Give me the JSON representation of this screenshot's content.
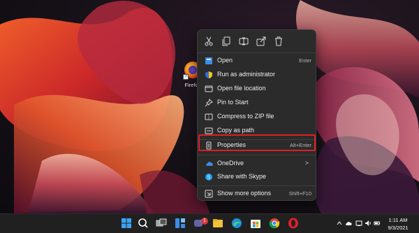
{
  "desktop": {
    "icon_label": "Firefox",
    "wallpaper": "abstract-ribbons"
  },
  "context_menu": {
    "quick_actions": [
      {
        "name": "cut",
        "icon": "scissors-icon"
      },
      {
        "name": "copy",
        "icon": "copy-icon"
      },
      {
        "name": "rename",
        "icon": "rename-icon"
      },
      {
        "name": "share",
        "icon": "share-icon"
      },
      {
        "name": "delete",
        "icon": "trash-icon"
      }
    ],
    "items": [
      {
        "label": "Open",
        "shortcut": "Enter",
        "icon": "open-icon"
      },
      {
        "label": "Run as administrator",
        "shortcut": "",
        "icon": "shield-icon"
      },
      {
        "label": "Open file location",
        "shortcut": "",
        "icon": "folder-icon"
      },
      {
        "label": "Pin to Start",
        "shortcut": "",
        "icon": "pin-icon"
      },
      {
        "label": "Compress to ZIP file",
        "shortcut": "",
        "icon": "zip-icon"
      },
      {
        "label": "Copy as path",
        "shortcut": "",
        "icon": "copy-path-icon"
      },
      {
        "label": "Properties",
        "shortcut": "Alt+Enter",
        "icon": "properties-icon"
      },
      {
        "label": "OneDrive",
        "shortcut": "",
        "icon": "cloud-icon",
        "submenu": ">"
      },
      {
        "label": "Share with Skype",
        "shortcut": "",
        "icon": "skype-icon"
      },
      {
        "label": "Show more options",
        "shortcut": "Shift+F10",
        "icon": "more-options-icon"
      }
    ],
    "highlighted_item": "Properties",
    "highlight_color": "#e02020"
  },
  "taskbar": {
    "apps": [
      "start-icon",
      "search-icon",
      "task-view-icon",
      "widgets-icon",
      "teams-chat-icon",
      "file-explorer-icon",
      "edge-icon",
      "store-icon",
      "chrome-icon",
      "opera-icon"
    ],
    "chat_badge": "1",
    "clock": {
      "time": "1:11 AM",
      "date": "9/3/2021"
    },
    "tray_icons": [
      "chevron-up-icon",
      "cloud-icon",
      "wifi-icon",
      "volume-icon",
      "notification-icon"
    ]
  }
}
